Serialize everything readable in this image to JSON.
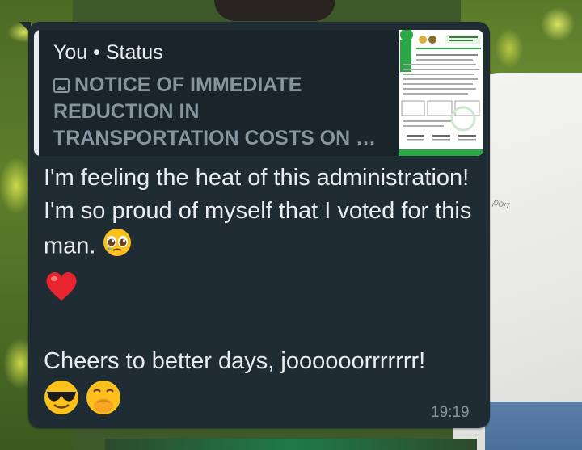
{
  "status_reply": {
    "author": "You • Status",
    "media_icon": "image-icon",
    "text": "NOTICE OF IMMEDIATE REDUCTION IN TRANSPORTATION COSTS ON …"
  },
  "message": {
    "line1": "I'm feeling the heat of this administration! I'm so proud of myself that I voted for this man.",
    "emoji_after_line1": "pleading-face-emoji",
    "emoji_heart": "red-heart-emoji",
    "line2": "Cheers to better days, joooooorrrrrrr!",
    "emojis_after_line2": [
      "smiling-face-with-sunglasses-emoji",
      "face-with-hand-over-mouth-emoji"
    ],
    "time": "19:19"
  },
  "background_text": "port",
  "colors": {
    "bubble": "#1f2c34",
    "quote_bg": "#1a242b",
    "primary_text": "#e9edef",
    "secondary_text": "#8696a0"
  }
}
